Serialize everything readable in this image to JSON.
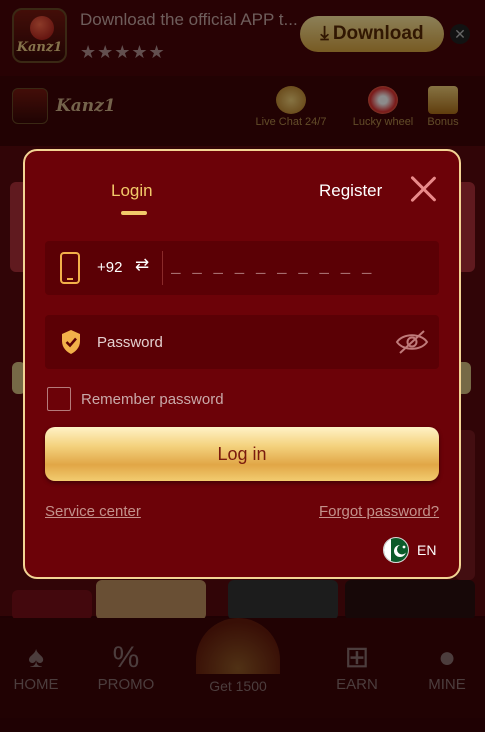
{
  "banner": {
    "logo_text": "Kanz1",
    "text": "Download the official APP t...",
    "stars": "★★★★★",
    "download_label": "Download",
    "close": "✕"
  },
  "header": {
    "brand": "Kanz1",
    "items": [
      {
        "label": "Live Chat 24/7",
        "icon": "headset-icon"
      },
      {
        "label": "Lucky wheel",
        "icon": "wheel-icon"
      },
      {
        "label": "Bonus",
        "icon": "gift-icon"
      }
    ]
  },
  "bottom_nav": {
    "home": "HOME",
    "promo": "PROMO",
    "get": "Get 1500",
    "earn": "EARN",
    "mine": "MINE"
  },
  "modal": {
    "tab_login": "Login",
    "tab_register": "Register",
    "country_code": "+92",
    "swap_glyph": "⇄",
    "phone_placeholder": "_ _ _ _ _ _ _ _ _ _",
    "password_placeholder": "Password",
    "remember_label": "Remember password",
    "login_button": "Log in",
    "service_center": "Service center",
    "forgot_password": "Forgot password?",
    "language": "EN"
  },
  "colors": {
    "modal_bg": "#6c0208",
    "accent_gold": "#f2c96a",
    "field_bg": "#5b0005"
  }
}
